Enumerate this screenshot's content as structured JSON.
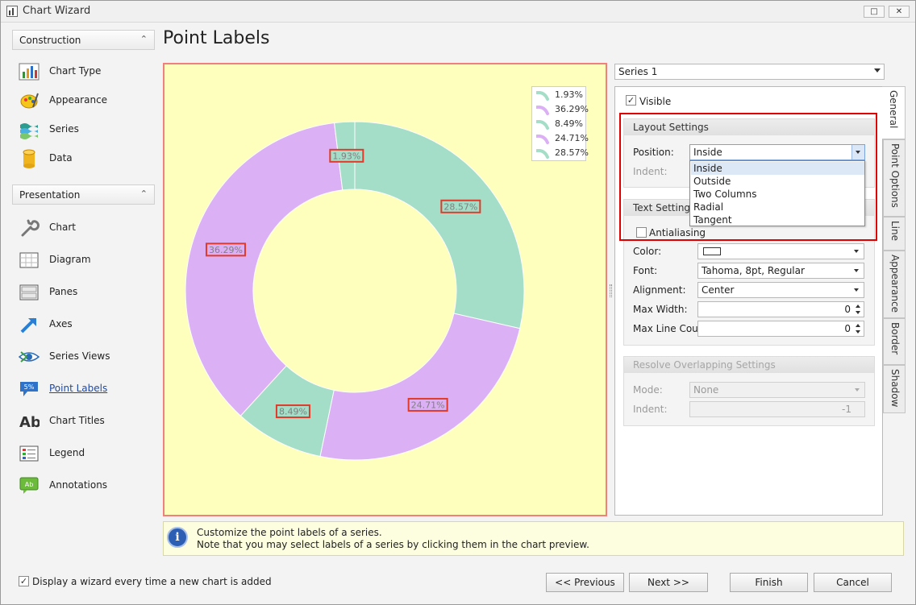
{
  "window": {
    "title": "Chart Wizard",
    "restore_label": "□",
    "close_label": "✕"
  },
  "nav": {
    "construction": {
      "header": "Construction",
      "items": [
        {
          "label": "Chart Type",
          "icon": "chart-type-icon"
        },
        {
          "label": "Appearance",
          "icon": "appearance-icon"
        },
        {
          "label": "Series",
          "icon": "series-icon"
        },
        {
          "label": "Data",
          "icon": "data-icon"
        }
      ]
    },
    "presentation": {
      "header": "Presentation",
      "items": [
        {
          "label": "Chart",
          "icon": "wrench-icon"
        },
        {
          "label": "Diagram",
          "icon": "diagram-icon"
        },
        {
          "label": "Panes",
          "icon": "panes-icon"
        },
        {
          "label": "Axes",
          "icon": "axes-icon"
        },
        {
          "label": "Series Views",
          "icon": "series-views-icon"
        },
        {
          "label": "Point Labels",
          "icon": "point-labels-icon"
        },
        {
          "label": "Chart Titles",
          "icon": "chart-titles-icon"
        },
        {
          "label": "Legend",
          "icon": "legend-icon"
        },
        {
          "label": "Annotations",
          "icon": "annotations-icon"
        }
      ]
    }
  },
  "page": {
    "title": "Point Labels"
  },
  "colors": {
    "teal": "#a4ddc8",
    "lilac": "#dcb0f5",
    "chart_bg": "#fefebd",
    "label_border": "#e03a2a"
  },
  "chart_data": {
    "type": "pie",
    "hole": 0.6,
    "values": [
      28.57,
      24.71,
      8.49,
      36.29,
      1.93
    ],
    "labels": [
      "28.57%",
      "24.71%",
      "8.49%",
      "36.29%",
      "1.93%"
    ],
    "legend": [
      "1.93%",
      "36.29%",
      "8.49%",
      "24.71%",
      "28.57%"
    ],
    "legend_placement": "top-right"
  },
  "props": {
    "series_select": "Series 1",
    "visible_label": "Visible",
    "layout": {
      "header": "Layout Settings",
      "position_label": "Position:",
      "position_value": "Inside",
      "indent_label": "Indent:"
    },
    "position_options": [
      "Inside",
      "Outside",
      "Two Columns",
      "Radial",
      "Tangent"
    ],
    "text": {
      "header": "Text Settings",
      "header_visible": "Text Setting",
      "antialiasing_label": "Antialiasing",
      "color_label": "Color:",
      "font_label": "Font:",
      "font_value": "Tahoma, 8pt, Regular",
      "alignment_label": "Alignment:",
      "alignment_value": "Center",
      "max_width_label": "Max Width:",
      "max_width_value": "0",
      "max_line_count_label": "Max Line Coun",
      "max_line_count_value": "0"
    },
    "resolve": {
      "header": "Resolve Overlapping Settings",
      "mode_label": "Mode:",
      "mode_value": "None",
      "indent_label": "Indent:",
      "indent_value": "-1"
    }
  },
  "tabs": [
    "General",
    "Point Options",
    "Line",
    "Appearance",
    "Border",
    "Shadow"
  ],
  "info": {
    "line1": "Customize the point labels of a series.",
    "line2": "Note that you may select labels of a series by clicking them in the chart preview.",
    "badge": "i"
  },
  "footer": {
    "checkbox_label": "Display a wizard every time a new chart is added",
    "previous": "<< Previous",
    "next": "Next >>",
    "finish": "Finish",
    "cancel": "Cancel"
  }
}
